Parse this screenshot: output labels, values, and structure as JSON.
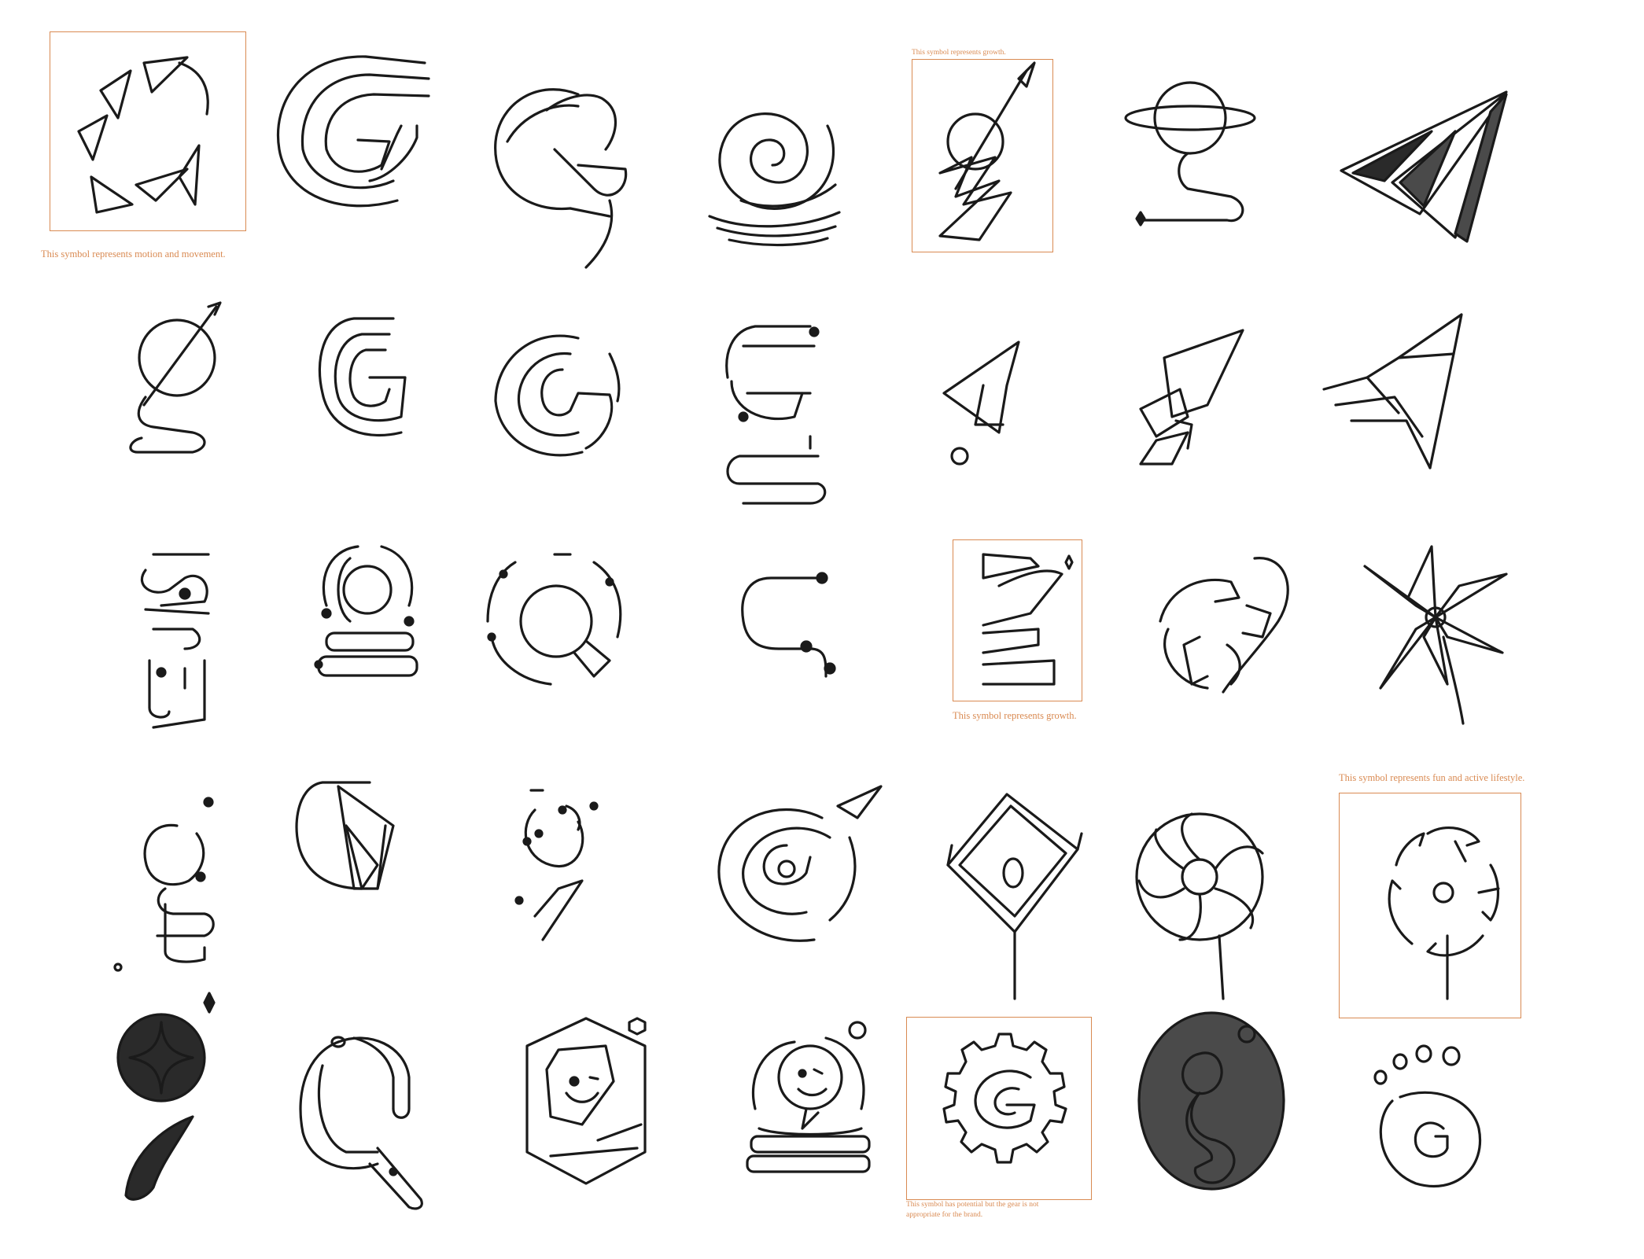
{
  "accent_color": "#d98a52",
  "notes": {
    "motion": "This symbol represents motion and movement.",
    "growth_top": "This symbol represents growth.",
    "growth_mid": "This symbol represents growth.",
    "fun": "This symbol represents fun and active lifestyle.",
    "gear_line1": "This symbol has potential but the gear is not",
    "gear_line2": "appropriate for the brand."
  }
}
